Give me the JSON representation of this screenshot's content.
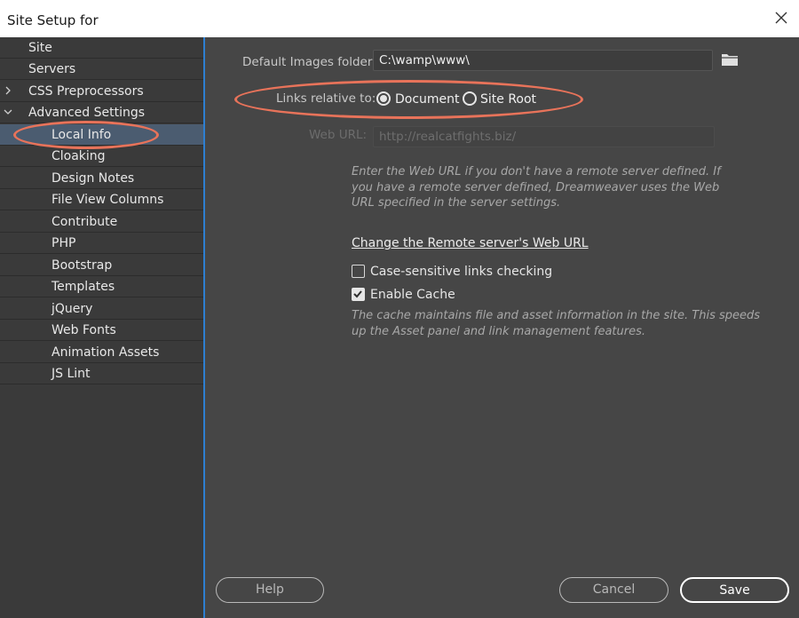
{
  "window": {
    "title": "Site Setup for"
  },
  "sidebar": {
    "items": [
      {
        "label": "Site"
      },
      {
        "label": "Servers"
      },
      {
        "label": "CSS Preprocessors"
      },
      {
        "label": "Advanced Settings"
      },
      {
        "label": "Local Info"
      },
      {
        "label": "Cloaking"
      },
      {
        "label": "Design Notes"
      },
      {
        "label": "File View Columns"
      },
      {
        "label": "Contribute"
      },
      {
        "label": "PHP"
      },
      {
        "label": "Bootstrap"
      },
      {
        "label": "Templates"
      },
      {
        "label": "jQuery"
      },
      {
        "label": "Web Fonts"
      },
      {
        "label": "Animation Assets"
      },
      {
        "label": "JS Lint"
      }
    ],
    "selected": "Local Info"
  },
  "main": {
    "images_folder_label": "Default Images folder:",
    "images_folder_value": "C:\\wamp\\www\\",
    "links_relative_label": "Links relative to:",
    "radio_document": "Document",
    "radio_site_root": "Site Root",
    "links_relative_selected": "Document",
    "web_url_label": "Web URL:",
    "web_url_value": "http://realcatfights.biz/",
    "web_url_hint": "Enter the Web URL if you don't have a remote server defined. If you have a remote server defined, Dreamweaver uses the Web URL specified in the server settings.",
    "change_remote_link": "Change the Remote server's Web URL",
    "case_sensitive_label": "Case-sensitive links checking",
    "case_sensitive_checked": false,
    "enable_cache_label": "Enable Cache",
    "enable_cache_checked": true,
    "cache_hint": "The cache maintains file and asset information in the site. This speeds up the Asset panel and link management features."
  },
  "footer": {
    "help": "Help",
    "cancel": "Cancel",
    "save": "Save"
  },
  "colors": {
    "annotation": "#e8735a",
    "selection": "#4b5c70",
    "sidebar_border": "#2e7fd1"
  }
}
